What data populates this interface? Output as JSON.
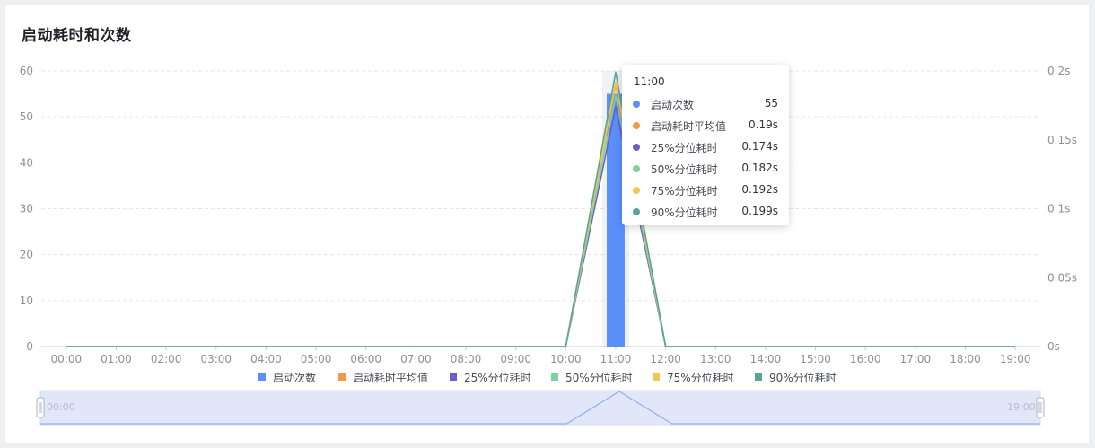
{
  "card": {
    "title": "启动耗时和次数"
  },
  "colors": {
    "bar": "#5b8ff9",
    "avg": "#f09a4a",
    "p25": "#6b5fc8",
    "p50": "#7fd1a1",
    "p75": "#f0c84e",
    "p90": "#5aa39a",
    "zoom_fill": "#e1e7f9"
  },
  "chart_data": {
    "type": "bar",
    "categories": [
      "00:00",
      "01:00",
      "02:00",
      "03:00",
      "04:00",
      "05:00",
      "06:00",
      "07:00",
      "08:00",
      "09:00",
      "10:00",
      "11:00",
      "12:00",
      "13:00",
      "14:00",
      "15:00",
      "16:00",
      "17:00",
      "18:00",
      "19:00"
    ],
    "left_axis": {
      "ticks": [
        "0",
        "10",
        "20",
        "30",
        "40",
        "50",
        "60"
      ],
      "ylim": [
        0,
        60
      ]
    },
    "right_axis": {
      "ticks": [
        "0s",
        "0.05s",
        "0.1s",
        "0.15s",
        "0.2s"
      ],
      "ylim": [
        0,
        0.2
      ]
    },
    "series": [
      {
        "name": "启动次数",
        "kind": "bar",
        "axis": "left",
        "values": [
          0,
          0,
          0,
          0,
          0,
          0,
          0,
          0,
          0,
          0,
          0,
          55,
          0,
          0,
          0,
          0,
          0,
          0,
          0,
          0
        ]
      },
      {
        "name": "启动耗时平均值",
        "kind": "line",
        "axis": "right",
        "values": [
          0,
          0,
          0,
          0,
          0,
          0,
          0,
          0,
          0,
          0,
          0,
          0.19,
          0,
          0,
          0,
          0,
          0,
          0,
          0,
          0
        ]
      },
      {
        "name": "25%分位耗时",
        "kind": "line",
        "axis": "right",
        "values": [
          0,
          0,
          0,
          0,
          0,
          0,
          0,
          0,
          0,
          0,
          0,
          0.174,
          0,
          0,
          0,
          0,
          0,
          0,
          0,
          0
        ]
      },
      {
        "name": "50%分位耗时",
        "kind": "line",
        "axis": "right",
        "values": [
          0,
          0,
          0,
          0,
          0,
          0,
          0,
          0,
          0,
          0,
          0,
          0.182,
          0,
          0,
          0,
          0,
          0,
          0,
          0,
          0
        ]
      },
      {
        "name": "75%分位耗时",
        "kind": "line",
        "axis": "right",
        "values": [
          0,
          0,
          0,
          0,
          0,
          0,
          0,
          0,
          0,
          0,
          0,
          0.192,
          0,
          0,
          0,
          0,
          0,
          0,
          0,
          0
        ]
      },
      {
        "name": "90%分位耗时",
        "kind": "line",
        "axis": "right",
        "values": [
          0,
          0,
          0,
          0,
          0,
          0,
          0,
          0,
          0,
          0,
          0,
          0.199,
          0,
          0,
          0,
          0,
          0,
          0,
          0,
          0
        ]
      }
    ],
    "grid": true,
    "legend": "bottom",
    "highlighted_category": "11:00"
  },
  "tooltip": {
    "time": "11:00",
    "rows": [
      {
        "label": "启动次数",
        "value": "55"
      },
      {
        "label": "启动耗时平均值",
        "value": "0.19s"
      },
      {
        "label": "25%分位耗时",
        "value": "0.174s"
      },
      {
        "label": "50%分位耗时",
        "value": "0.182s"
      },
      {
        "label": "75%分位耗时",
        "value": "0.192s"
      },
      {
        "label": "90%分位耗时",
        "value": "0.199s"
      }
    ]
  },
  "data_zoom": {
    "start_label": "00:00",
    "end_label": "19:00"
  }
}
